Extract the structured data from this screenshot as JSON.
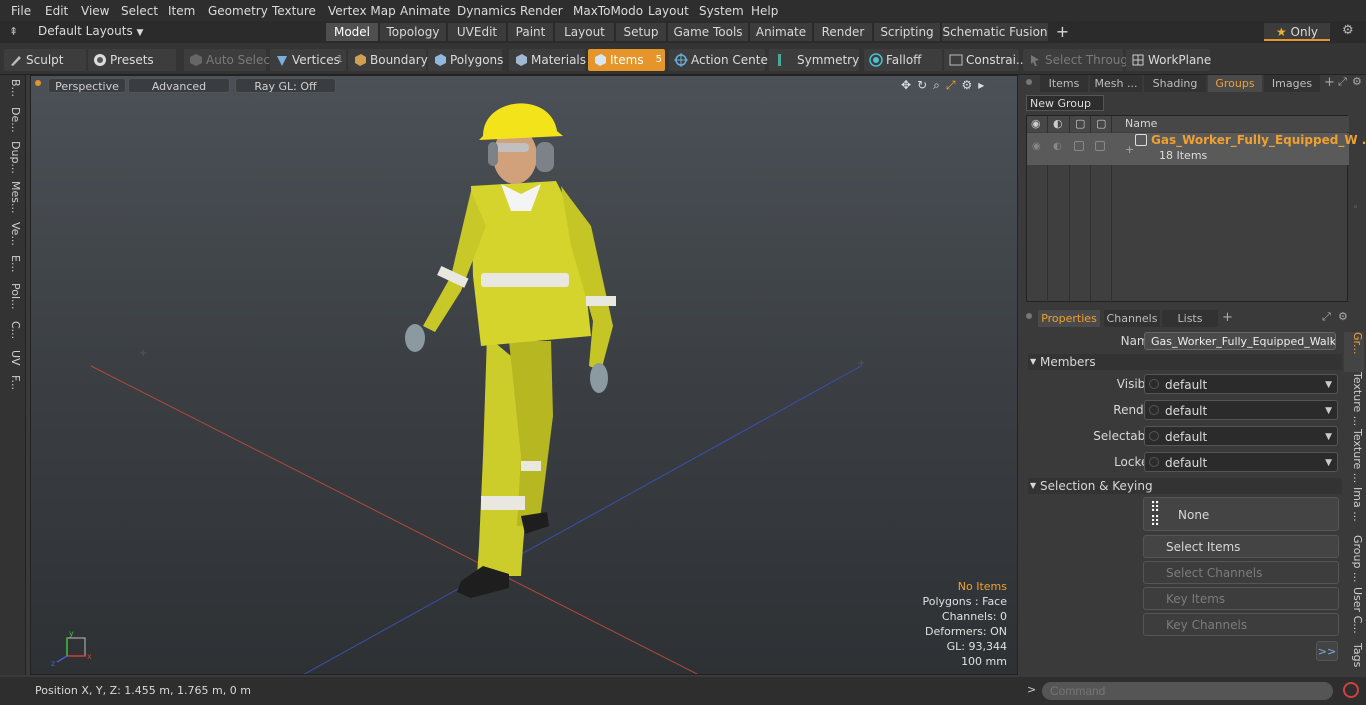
{
  "menu": [
    "File",
    "Edit",
    "View",
    "Select",
    "Item",
    "Geometry",
    "Texture",
    "Vertex Map",
    "Animate",
    "Dynamics",
    "Render",
    "MaxToModo",
    "Layout",
    "System",
    "Help"
  ],
  "layout_dropdown": "Default Layouts",
  "layout_tabs": [
    "Model",
    "Topology",
    "UVEdit",
    "Paint",
    "Layout",
    "Setup",
    "Game Tools",
    "Animate",
    "Render",
    "Scripting",
    "Schematic Fusion"
  ],
  "only_label": "Only",
  "toolbar": {
    "sculpt": "Sculpt",
    "presets": "Presets",
    "auto_select": "Auto Select",
    "vertices": "Vertices",
    "vertices_count": "1",
    "boundary": "Boundary",
    "polygons": "Polygons",
    "materials": "Materials",
    "items": "Items",
    "items_count": "5",
    "action_center": "Action Center",
    "symmetry": "Symmetry",
    "falloff": "Falloff",
    "constraints": "Constrai...",
    "select_through": "Select Through",
    "workplane": "WorkPlane"
  },
  "left_tabs": [
    "B...",
    "De...",
    "Dup...",
    "Mes...",
    "Ve...",
    "E...",
    "Pol...",
    "C...",
    "UV",
    "F..."
  ],
  "viewport": {
    "perspective": "Perspective",
    "advanced": "Advanced",
    "ray_gl": "Ray GL: Off",
    "info": {
      "no_items": "No Items",
      "polygons": "Polygons : Face",
      "channels": "Channels: 0",
      "deformers": "Deformers: ON",
      "gl": "GL: 93,344",
      "scale": "100 mm"
    },
    "axis_x": "x",
    "axis_y": "y",
    "axis_z": "z"
  },
  "status": {
    "position": "Position X, Y, Z:   1.455 m, 1.765 m, 0 m"
  },
  "groups_panel": {
    "tabs": [
      "Items",
      "Mesh ...",
      "Shading",
      "Groups",
      "Images"
    ],
    "active_tab": "Groups",
    "new_group": "New Group",
    "col_name": "Name",
    "group_name": "Gas_Worker_Fully_Equipped_W ...",
    "group_count": "18 Items"
  },
  "properties_panel": {
    "tabs": [
      "Properties",
      "Channels",
      "Lists"
    ],
    "name_label": "Name",
    "name_value": "Gas_Worker_Fully_Equipped_Walking",
    "members_section": "Members",
    "fields": [
      {
        "label": "Visible",
        "value": "default"
      },
      {
        "label": "Render",
        "value": "default"
      },
      {
        "label": "Selectable",
        "value": "default"
      },
      {
        "label": "Locked",
        "value": "default"
      }
    ],
    "selection_section": "Selection & Keying",
    "none_label": "None",
    "select_items": "Select Items",
    "select_channels": "Select Channels",
    "key_items": "Key Items",
    "key_channels": "Key Channels",
    "more": ">>",
    "side_tabs": [
      "Gr...",
      "Texture ...",
      "Texture ...",
      "Ima ...",
      "Group ...",
      "User C...",
      "Tags"
    ]
  },
  "command": {
    "placeholder": "Command"
  }
}
